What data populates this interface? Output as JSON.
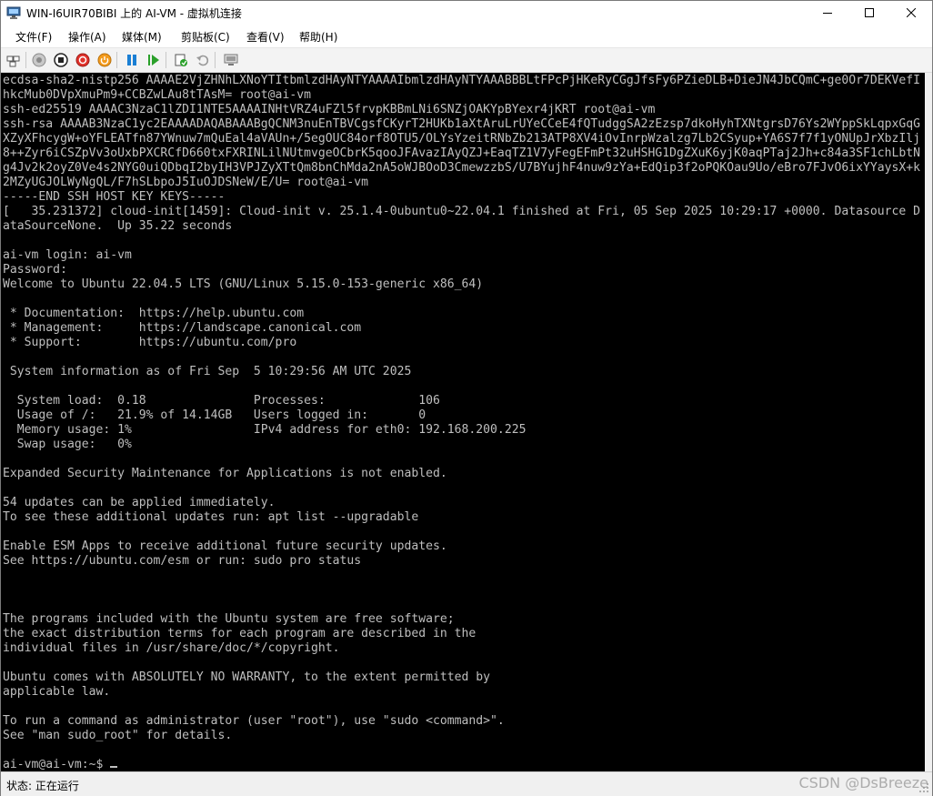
{
  "window": {
    "title": "WIN-I6UIR70BIBI 上的 AI-VM - 虚拟机连接",
    "controls": [
      "minimize",
      "maximize",
      "close"
    ]
  },
  "menu": {
    "items": [
      {
        "label": "文件(F)"
      },
      {
        "label": "操作(A)"
      },
      {
        "label": "媒体(M)"
      },
      {
        "label": "剪贴板(C)"
      },
      {
        "label": "查看(V)"
      },
      {
        "label": "帮助(H)"
      }
    ]
  },
  "toolbar": {
    "buttons": [
      "ctrl-alt-del-icon",
      "start-icon",
      "turn-off-icon",
      "shutdown-icon",
      "power-icon",
      "pause-icon",
      "resume-icon",
      "checkpoint-icon",
      "revert-icon",
      "enhanced-session-icon"
    ],
    "accent": "#1a7fd4"
  },
  "terminal": {
    "background": "#000000",
    "foreground": "#bfbfbf",
    "lines": [
      "ecdsa-sha2-nistp256 AAAAE2VjZHNhLXNoYTItbmlzdHAyNTYAAAAIbmlzdHAyNTYAAABBBLtFPcPjHKeRyCGgJfsFy6PZieDLB+DieJN4JbCQmC+ge0Or7DEKVefI",
      "hkcMub0DVpXmuPm9+CCBZwLAu8tTAsM= root@ai-vm",
      "ssh-ed25519 AAAAC3NzaC1lZDI1NTE5AAAAINHtVRZ4uFZl5frvpKBBmLNi6SNZjOAKYpBYexr4jKRT root@ai-vm",
      "ssh-rsa AAAAB3NzaC1yc2EAAAADAQABAAABgQCNM3nuEnTBVCgsfCKyrT2HUKb1aXtAruLrUYeCCeE4fQTudggSA2zEzsp7dkoHyhTXNtgrsD76Ys2WYppSkLqpxGqG",
      "XZyXFhcygW+oYFLEATfn87YWnuw7mQuEal4aVAUn+/5egOUC84orf8OTU5/OLYsYzeitRNbZb213ATP8XV4iOvInrpWzalzg7Lb2CSyup+YA6S7f7f1yONUpJrXbzIlj",
      "8++Zyr6iCSZpVv3oUxbPXCRCfD660txFXRINLilNUtmvgeOCbrK5qooJFAvazIAyQZJ+EaqTZ1V7yFegEFmPt32uHSHG1DgZXuK6yjK0aqPTaj2Jh+c84a3SF1chLbtN",
      "g4Jv2k2oyZ0Ve4s2NYG0uiQDbqI2byIH3VPJZyXTtQm8bnChMda2nA5oWJBOoD3CmewzzbS/U7BYujhF4nuw9zYa+EdQip3f2oPQKOau9Uo/eBro7FJvO6ixYYaysX+k",
      "2MZyUGJOLWyNgQL/F7hSLbpoJ5IuOJDSNeW/E/U= root@ai-vm",
      "-----END SSH HOST KEY KEYS-----",
      "[   35.231372] cloud-init[1459]: Cloud-init v. 25.1.4-0ubuntu0~22.04.1 finished at Fri, 05 Sep 2025 10:29:17 +0000. Datasource D",
      "ataSourceNone.  Up 35.22 seconds",
      "",
      "ai-vm login: ai-vm",
      "Password:",
      "Welcome to Ubuntu 22.04.5 LTS (GNU/Linux 5.15.0-153-generic x86_64)",
      "",
      " * Documentation:  https://help.ubuntu.com",
      " * Management:     https://landscape.canonical.com",
      " * Support:        https://ubuntu.com/pro",
      "",
      " System information as of Fri Sep  5 10:29:56 AM UTC 2025",
      "",
      "  System load:  0.18               Processes:             106",
      "  Usage of /:   21.9% of 14.14GB   Users logged in:       0",
      "  Memory usage: 1%                 IPv4 address for eth0: 192.168.200.225",
      "  Swap usage:   0%",
      "",
      "Expanded Security Maintenance for Applications is not enabled.",
      "",
      "54 updates can be applied immediately.",
      "To see these additional updates run: apt list --upgradable",
      "",
      "Enable ESM Apps to receive additional future security updates.",
      "See https://ubuntu.com/esm or run: sudo pro status",
      "",
      "",
      "",
      "The programs included with the Ubuntu system are free software;",
      "the exact distribution terms for each program are described in the",
      "individual files in /usr/share/doc/*/copyright.",
      "",
      "Ubuntu comes with ABSOLUTELY NO WARRANTY, to the extent permitted by",
      "applicable law.",
      "",
      "To run a command as administrator (user \"root\"), use \"sudo <command>\".",
      "See \"man sudo_root\" for details.",
      "",
      "ai-vm@ai-vm:~$ "
    ]
  },
  "status": {
    "text": "状态: 正在运行"
  },
  "watermark": "CSDN @DsBreeze"
}
